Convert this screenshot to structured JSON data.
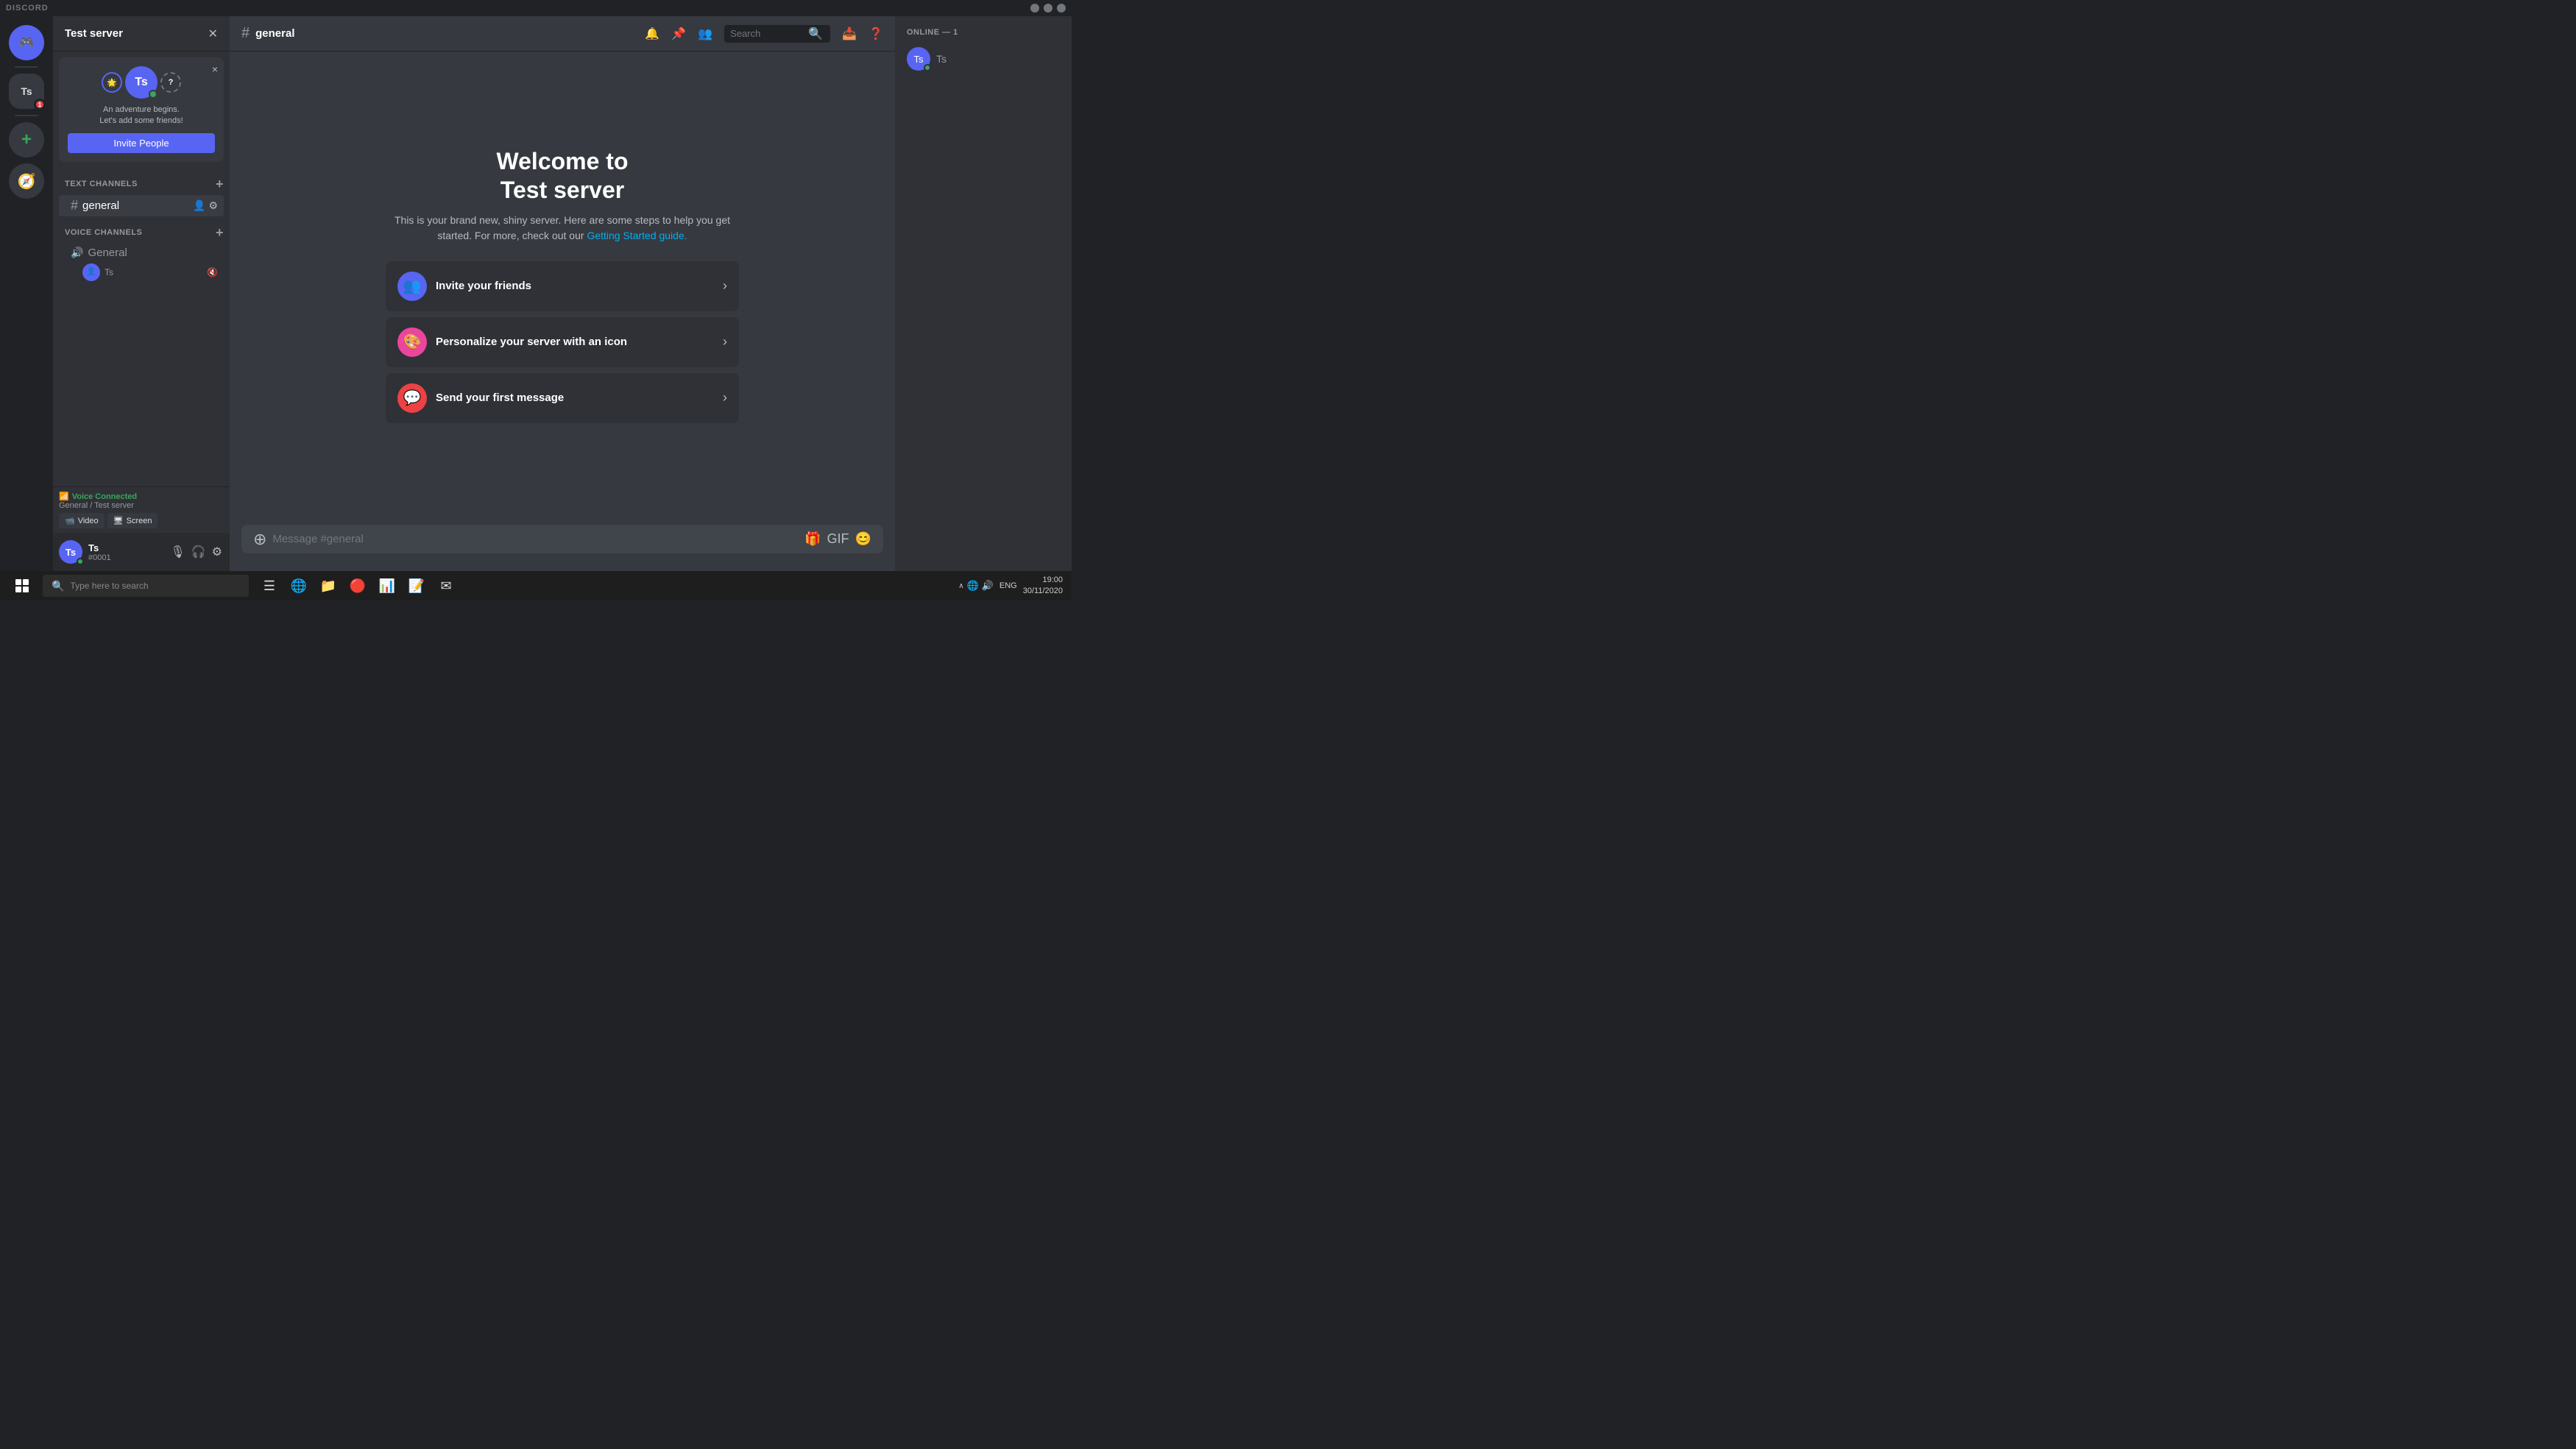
{
  "titlebar": {
    "title": "DISCORD",
    "min": "−",
    "max": "□",
    "close": "×"
  },
  "server_sidebar": {
    "discord_icon": "🎮",
    "test_server_label": "Ts",
    "add_server_icon": "+",
    "explore_icon": "🧭"
  },
  "channel_sidebar": {
    "server_name": "Test server",
    "invite_popup": {
      "text_line1": "An adventure begins.",
      "text_line2": "Let's add some friends!",
      "button_label": "Invite People",
      "close": "×"
    },
    "text_channels_label": "TEXT CHANNELS",
    "voice_channels_label": "VOICE CHANNELS",
    "text_channels": [
      {
        "name": "general",
        "active": true
      }
    ],
    "voice_channels": [
      {
        "name": "General",
        "active": false
      }
    ],
    "voice_user_icon": "👤"
  },
  "voice_connected": {
    "status_label": "Voice Connected",
    "channel_info": "General / Test server",
    "video_btn": "Video",
    "screen_btn": "Screen"
  },
  "user_panel": {
    "name": "Ts",
    "username": "Ts",
    "tag": "#0001"
  },
  "channel_header": {
    "channel_icon": "#",
    "channel_name": "general",
    "search_placeholder": "Search"
  },
  "welcome": {
    "title_line1": "Welcome to",
    "title_line2": "Test server",
    "description": "This is your brand new, shiny server. Here are some steps to help you get started. For more, check out our",
    "link_text": "Getting Started guide.",
    "actions": [
      {
        "title": "Invite your friends",
        "icon_text": "👥",
        "color_class": "invite"
      },
      {
        "title": "Personalize your server with an icon",
        "icon_text": "🎨",
        "color_class": "personalize"
      },
      {
        "title": "Send your first message",
        "icon_text": "💬",
        "color_class": "message"
      }
    ]
  },
  "message_input": {
    "placeholder": "Message #general"
  },
  "right_sidebar": {
    "online_header": "ONLINE — 1",
    "online_users": [
      {
        "name": "Ts",
        "avatar_text": "Ts"
      }
    ]
  },
  "taskbar": {
    "search_placeholder": "Type here to search",
    "apps": [
      "⬡",
      "☰",
      "📁",
      "🌐",
      "🔴",
      "📊",
      "✉",
      "📋"
    ],
    "time": "19:00",
    "date": "30/11/2020",
    "lang": "ENG"
  }
}
